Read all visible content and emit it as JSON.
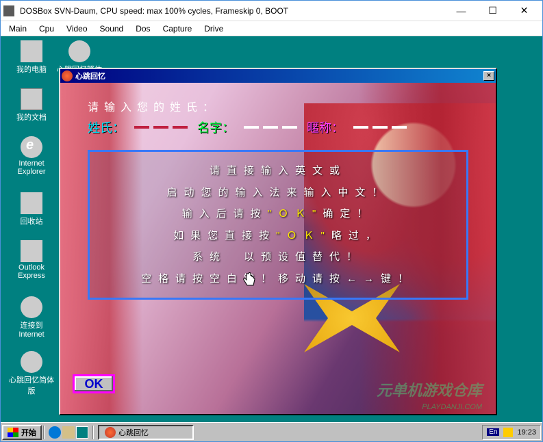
{
  "window": {
    "title": "DOSBox SVN-Daum, CPU speed: max 100% cycles, Frameskip  0,    BOOT"
  },
  "menu": {
    "main": "Main",
    "cpu": "Cpu",
    "video": "Video",
    "sound": "Sound",
    "dos": "Dos",
    "capture": "Capture",
    "drive": "Drive"
  },
  "desktop_icons": {
    "my_computer": "我的电脑",
    "game_trad": "心跳回忆繁体",
    "my_documents": "我的文档",
    "ie": "Internet Explorer",
    "recycle": "回收站",
    "outlook": "Outlook Express",
    "connect": "连接到 Internet",
    "game_simp": "心跳回忆简体版"
  },
  "game": {
    "title": "心跳回忆",
    "prompt": "请输入您的姓氏：",
    "label_surname": "姓氏：",
    "label_given": "名字：",
    "label_nick": "暱称：",
    "help_lines": [
      "请直接输入英文或",
      "启动您的输入法来输入中文！",
      "输入后请按\"ＯＫ\"确定！",
      "如果您直接按\"ＯＫ\"略过，",
      "系统　以预设值替代！",
      "空格请按空白键！移动请按←→键！"
    ],
    "ok_button": "OK",
    "watermark": "元单机游戏仓库",
    "watermark_url": "PLAYDANJI.COM"
  },
  "taskbar": {
    "start": "开始",
    "task_app": "心跳回忆",
    "ime": "En",
    "clock": "19:23"
  }
}
